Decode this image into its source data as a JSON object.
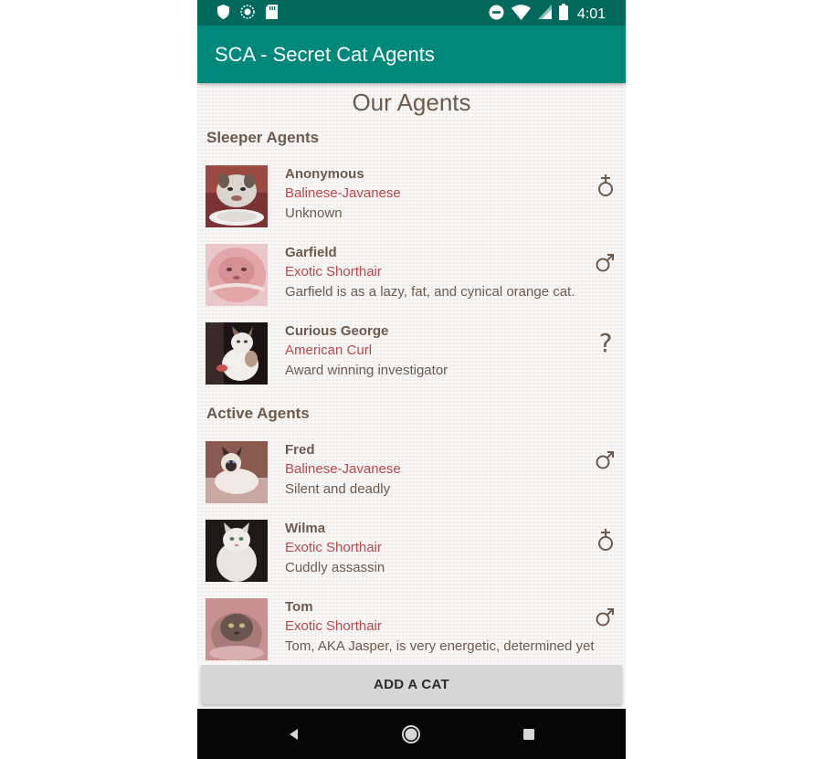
{
  "status_bar": {
    "time": "4:01",
    "left_icons": [
      "shield-icon",
      "radar-icon",
      "sd-card-icon"
    ],
    "right_icons": [
      "do-not-disturb-icon",
      "wifi-icon",
      "cell-signal-icon",
      "battery-icon"
    ]
  },
  "app_bar": {
    "title": "SCA - Secret Cat Agents",
    "color": "#00897b"
  },
  "page": {
    "heading": "Our Agents"
  },
  "sections": [
    {
      "title": "Sleeper Agents",
      "agents": [
        {
          "name": "Anonymous",
          "breed": "Balinese-Javanese",
          "description": "Unknown",
          "gender": "female-male-icon",
          "photo": "cat-with-plate"
        },
        {
          "name": "Garfield",
          "breed": "Exotic Shorthair",
          "description": "Garfield is as a lazy, fat, and cynical orange cat.",
          "gender": "male-icon",
          "photo": "persian-cat"
        },
        {
          "name": "Curious George",
          "breed": "American Curl",
          "description": "Award winning investigator",
          "gender": "question-mark",
          "gender_text": "?",
          "photo": "sitting-white-cat"
        }
      ]
    },
    {
      "title": "Active Agents",
      "agents": [
        {
          "name": "Fred",
          "breed": "Balinese-Javanese",
          "description": "Silent and deadly",
          "gender": "male-icon",
          "photo": "siamese-cat"
        },
        {
          "name": "Wilma",
          "breed": "Exotic Shorthair",
          "description": "Cuddly assassin",
          "gender": "female-male-icon",
          "photo": "white-fluffy-cat"
        },
        {
          "name": "Tom",
          "breed": "Exotic Shorthair",
          "description": "Tom, AKA Jasper, is very energetic, determined yet",
          "gender": "male-icon",
          "photo": "cat-in-bowl"
        }
      ]
    }
  ],
  "add_button": {
    "label": "ADD A CAT"
  },
  "nav_bar": {
    "buttons": [
      "back-icon",
      "home-icon",
      "recents-icon"
    ]
  },
  "colors": {
    "status_bar": "#00695c",
    "accent_text": "#b8484c",
    "body_text": "#6d5a4d"
  }
}
